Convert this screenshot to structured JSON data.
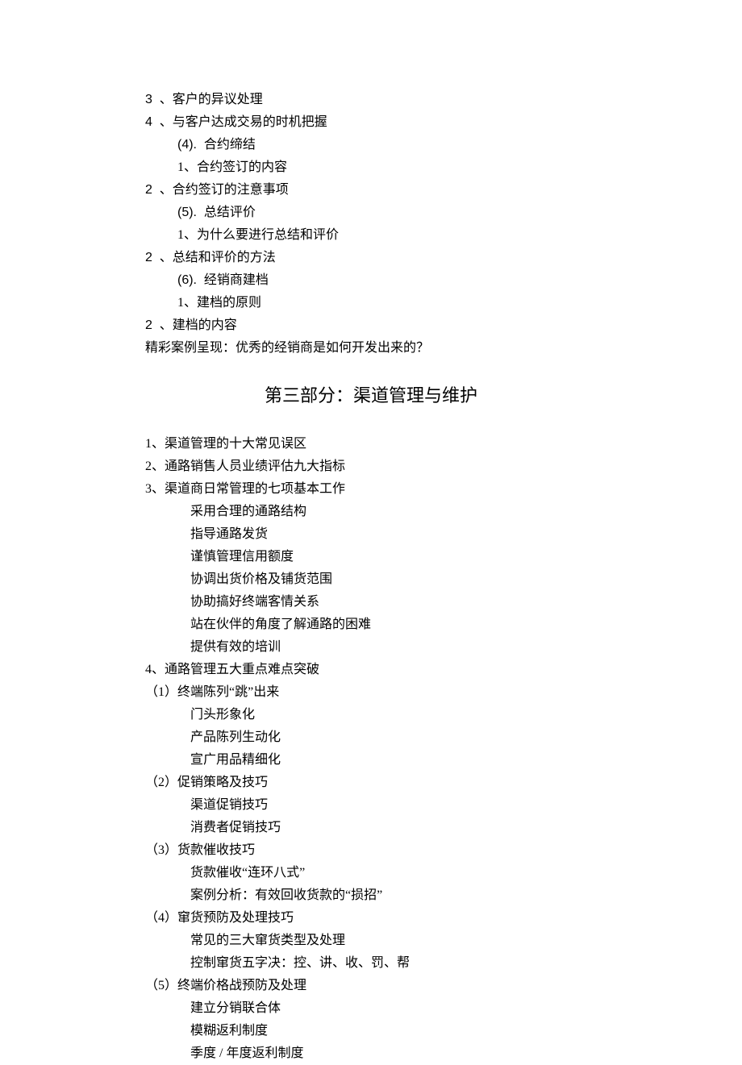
{
  "top_list": [
    {
      "cls": "line ind0",
      "html": "<span class='arial'>3&nbsp;&nbsp;</span>、客户的异议处理"
    },
    {
      "cls": "line ind0",
      "html": "<span class='arial'>4&nbsp;&nbsp;</span>、与客户达成交易的时机把握"
    },
    {
      "cls": "line ind1",
      "html": "<span class='arial'>(4).&nbsp;&nbsp;</span>合约缔结"
    },
    {
      "cls": "line ind1",
      "html": "1、合约签订的内容"
    },
    {
      "cls": "line ind0",
      "html": "<span class='arial'>2&nbsp;&nbsp;</span>、合约签订的注意事项"
    },
    {
      "cls": "line ind1",
      "html": "<span class='arial'>(5).&nbsp;&nbsp;</span>总结评价"
    },
    {
      "cls": "line ind1",
      "html": "1、为什么要进行总结和评价"
    },
    {
      "cls": "line ind0",
      "html": "<span class='arial'>2&nbsp;&nbsp;</span>、总结和评价的方法"
    },
    {
      "cls": "line ind1",
      "html": "<span class='arial'>(6).&nbsp;&nbsp;</span>经销商建档"
    },
    {
      "cls": "line ind1",
      "html": "1、建档的原则"
    },
    {
      "cls": "line ind0",
      "html": "<span class='arial'>2&nbsp;&nbsp;</span>、建档的内容"
    },
    {
      "cls": "line ind0",
      "html": "精彩案例呈现：优秀的经销商是如何开发出来的？"
    }
  ],
  "heading": "第三部分：渠道管理与维护",
  "bottom_list": [
    {
      "cls": "line ind0",
      "text": "1、渠道管理的十大常见误区"
    },
    {
      "cls": "line ind0",
      "text": "2、通路销售人员业绩评估九大指标"
    },
    {
      "cls": "line ind0",
      "text": "3、渠道商日常管理的七项基本工作"
    },
    {
      "cls": "line ind2",
      "text": "采用合理的通路结构"
    },
    {
      "cls": "line ind2",
      "text": "指导通路发货"
    },
    {
      "cls": "line ind2",
      "text": "谨慎管理信用额度"
    },
    {
      "cls": "line ind2",
      "text": "协调出货价格及铺货范围"
    },
    {
      "cls": "line ind2",
      "text": "协助搞好终端客情关系"
    },
    {
      "cls": "line ind2",
      "text": "站在伙伴的角度了解通路的困难"
    },
    {
      "cls": "line ind2",
      "text": "提供有效的培训"
    },
    {
      "cls": "line ind0",
      "text": "4、通路管理五大重点难点突破"
    },
    {
      "cls": "line ind0",
      "text": "（1）终端陈列“跳”出来"
    },
    {
      "cls": "line ind2",
      "text": "门头形象化"
    },
    {
      "cls": "line ind2",
      "text": "产品陈列生动化"
    },
    {
      "cls": "line ind2",
      "text": "宣广用品精细化"
    },
    {
      "cls": "line ind0",
      "text": "（2）促销策略及技巧"
    },
    {
      "cls": "line ind2",
      "text": "渠道促销技巧"
    },
    {
      "cls": "line ind2",
      "text": "消费者促销技巧"
    },
    {
      "cls": "line ind0",
      "text": "（3）货款催收技巧"
    },
    {
      "cls": "line ind2",
      "text": "货款催收“连环八式”"
    },
    {
      "cls": "line ind2",
      "text": "案例分析：有效回收货款的“损招”"
    },
    {
      "cls": "line ind0",
      "text": "（4）窜货预防及处理技巧"
    },
    {
      "cls": "line ind2",
      "text": "常见的三大窜货类型及处理"
    },
    {
      "cls": "line ind2",
      "text": "控制窜货五字决：控、讲、收、罚、帮"
    },
    {
      "cls": "line ind0",
      "text": "（5）终端价格战预防及处理"
    },
    {
      "cls": "line ind2",
      "text": "建立分销联合体"
    },
    {
      "cls": "line ind2",
      "text": "模糊返利制度"
    },
    {
      "cls": "line ind2",
      "text": "季度 / 年度返利制度"
    }
  ]
}
